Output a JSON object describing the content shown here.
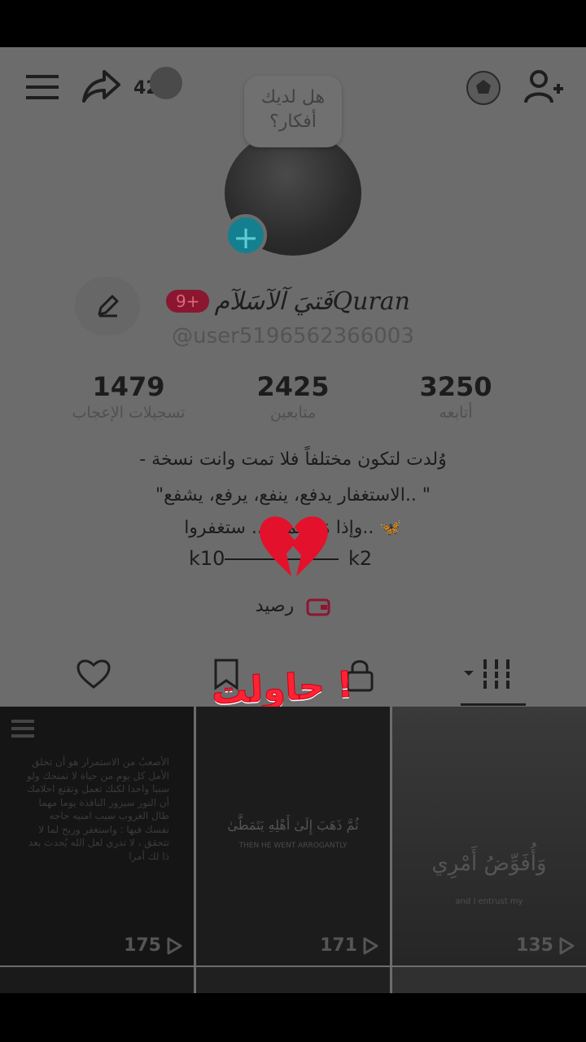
{
  "header": {
    "notification_count": "42",
    "idea_bubble": "هل لديك أفكار؟"
  },
  "profile": {
    "badge": "9+",
    "display_name": "فَتيَ آلآسَلآمQuran",
    "username": "@user5196562366003"
  },
  "stats": [
    {
      "value": "1479",
      "label": "تسجيلات الإعجاب"
    },
    {
      "value": "2425",
      "label": "متابعين"
    },
    {
      "value": "3250",
      "label": "أتابعه"
    }
  ],
  "bio": {
    "line1": "- وُلدت لتكون مختلفاً فلا تمت وانت نسخة",
    "line2": "\"الاستغفار يدفع، ينفع، يرفع، يشفع.. \"",
    "line3": "وإذا مَرَرتم م... ستغفروا.. 🦋",
    "left_tag": "k10",
    "right_tag": "k2"
  },
  "balance_label": "رصيد",
  "overlay_caption": "حاولت !",
  "videos": [
    {
      "views": "175",
      "text": "الأصعبُ من الاستمرار هو أن تخلق الأمل كل يوم من حياة لا تمنحك ولو سببا واحدا لكنك تعمل وتقنع احلامك أن النور سيزور النافذة يوما مهما طال الغروب سبب امنيه حاجه نفسك فيها : واستغفر وربح لما لا تتحقق ، لا تدري لعل الله يُحدث بعد ذا لك أمرا"
    },
    {
      "views": "171",
      "text": "ثُمَّ ذَهَبَ إِلَىٰ أَهْلِهِ يَتَمَطَّىٰ",
      "subtext": "THEN HE WENT ARROGANTLY"
    },
    {
      "views": "135",
      "text": "وَأُفَوِّضُ أَمْرِي",
      "subtext": "and I entrust my"
    }
  ],
  "colors": {
    "screen_dim": "#6c6c6c",
    "accent_red": "#ff2233",
    "badge": "#8b1630",
    "teal": "#14808f"
  },
  "icons": [
    "menu-icon",
    "share-icon",
    "football-icon",
    "add-friend-icon",
    "edit-icon",
    "wallet-icon",
    "heart-icon",
    "bookmark-icon",
    "lock-icon",
    "grid-icon",
    "play-icon"
  ]
}
